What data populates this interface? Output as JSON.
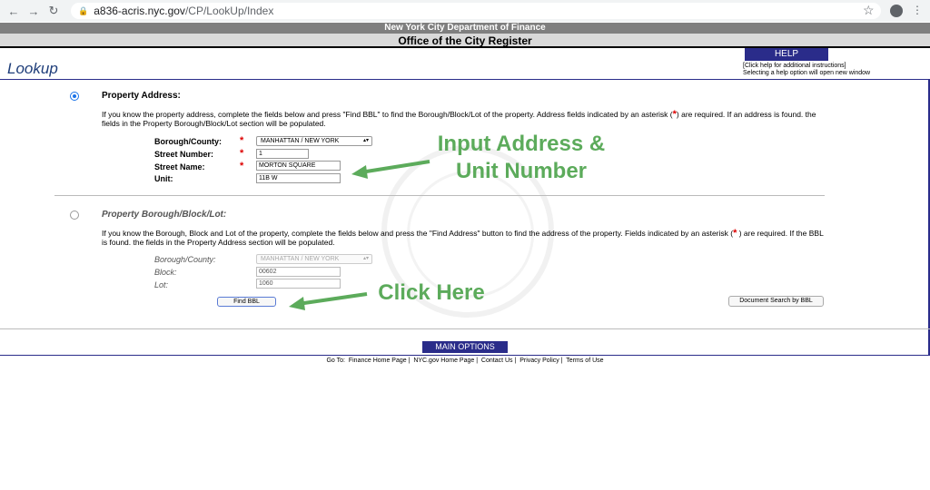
{
  "browser": {
    "url_host": "a836-acris.nyc.gov",
    "url_path": "/CP/LookUp/Index",
    "back_icon": "arrow-left-icon",
    "forward_icon": "arrow-right-icon",
    "reload_icon": "reload-icon"
  },
  "header": {
    "department": "New York City Department of Finance",
    "office": "Office of the City Register"
  },
  "page_title": "Lookup",
  "help": {
    "button": "HELP",
    "note_line1": "[Click help for additional instructions]",
    "note_line2": "Selecting a help option will open new window"
  },
  "address_section": {
    "title": "Property Address:",
    "desc_part1": "If you know the property address, complete the fields below and press \"Find BBL\" to find the Borough/Block/Lot of the property. Address fields indicated by an asterisk (",
    "desc_asterisk": "*",
    "desc_part2": ") are required. If an address is found. the fields in the Property Borough/Block/Lot section will be populated.",
    "borough_label": "Borough/County:",
    "borough_value": "MANHATTAN / NEW YORK",
    "street_number_label": "Street Number:",
    "street_number_value": "1",
    "street_name_label": "Street Name:",
    "street_name_value": "MORTON SQUARE",
    "unit_label": "Unit:",
    "unit_value": "11B W",
    "asterisk": "*"
  },
  "bbl_section": {
    "title": "Property Borough/Block/Lot:",
    "desc_part1": "If you know the Borough, Block and Lot of the property, complete the fields below and press the \"Find Address\" button to find the address of the property. Fields indicated by an asterisk (",
    "desc_asterisk": "*",
    "desc_part2": " ) are required. If the BBL is found. the fields in the Property Address section will be populated.",
    "borough_label": "Borough/County:",
    "borough_value": "MANHATTAN / NEW YORK",
    "block_label": "Block:",
    "block_value": "00602",
    "lot_label": "Lot:",
    "lot_value": "1060"
  },
  "buttons": {
    "find_bbl": "Find BBL",
    "document_search": "Document Search by BBL",
    "main_options": "MAIN OPTIONS"
  },
  "footer": {
    "goto": "Go To:",
    "links": [
      "Finance Home Page",
      "NYC.gov Home Page",
      "Contact Us",
      "Privacy Policy",
      "Terms of Use"
    ]
  },
  "annotations": {
    "input_line1": "Input Address &",
    "input_line2": "Unit Number",
    "click_here": "Click Here",
    "color": "#5cab5b"
  },
  "colors": {
    "accent_navy": "#2a2c8a",
    "required_red": "#dd0000",
    "title_blue": "#1f3e7a"
  }
}
